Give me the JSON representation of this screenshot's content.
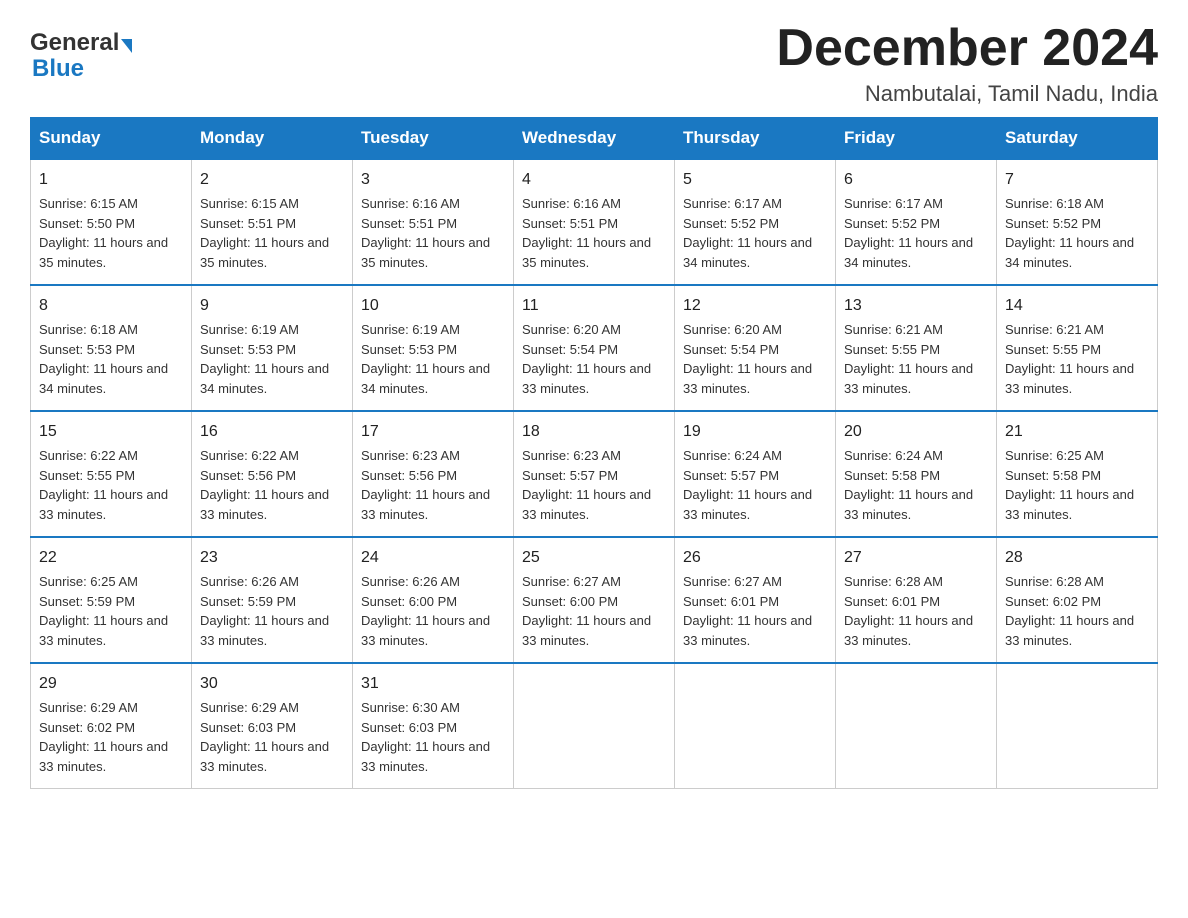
{
  "logo": {
    "general": "General",
    "blue": "Blue"
  },
  "title": "December 2024",
  "subtitle": "Nambutalai, Tamil Nadu, India",
  "headers": [
    "Sunday",
    "Monday",
    "Tuesday",
    "Wednesday",
    "Thursday",
    "Friday",
    "Saturday"
  ],
  "weeks": [
    [
      {
        "day": "1",
        "sunrise": "6:15 AM",
        "sunset": "5:50 PM",
        "daylight": "11 hours and 35 minutes."
      },
      {
        "day": "2",
        "sunrise": "6:15 AM",
        "sunset": "5:51 PM",
        "daylight": "11 hours and 35 minutes."
      },
      {
        "day": "3",
        "sunrise": "6:16 AM",
        "sunset": "5:51 PM",
        "daylight": "11 hours and 35 minutes."
      },
      {
        "day": "4",
        "sunrise": "6:16 AM",
        "sunset": "5:51 PM",
        "daylight": "11 hours and 35 minutes."
      },
      {
        "day": "5",
        "sunrise": "6:17 AM",
        "sunset": "5:52 PM",
        "daylight": "11 hours and 34 minutes."
      },
      {
        "day": "6",
        "sunrise": "6:17 AM",
        "sunset": "5:52 PM",
        "daylight": "11 hours and 34 minutes."
      },
      {
        "day": "7",
        "sunrise": "6:18 AM",
        "sunset": "5:52 PM",
        "daylight": "11 hours and 34 minutes."
      }
    ],
    [
      {
        "day": "8",
        "sunrise": "6:18 AM",
        "sunset": "5:53 PM",
        "daylight": "11 hours and 34 minutes."
      },
      {
        "day": "9",
        "sunrise": "6:19 AM",
        "sunset": "5:53 PM",
        "daylight": "11 hours and 34 minutes."
      },
      {
        "day": "10",
        "sunrise": "6:19 AM",
        "sunset": "5:53 PM",
        "daylight": "11 hours and 34 minutes."
      },
      {
        "day": "11",
        "sunrise": "6:20 AM",
        "sunset": "5:54 PM",
        "daylight": "11 hours and 33 minutes."
      },
      {
        "day": "12",
        "sunrise": "6:20 AM",
        "sunset": "5:54 PM",
        "daylight": "11 hours and 33 minutes."
      },
      {
        "day": "13",
        "sunrise": "6:21 AM",
        "sunset": "5:55 PM",
        "daylight": "11 hours and 33 minutes."
      },
      {
        "day": "14",
        "sunrise": "6:21 AM",
        "sunset": "5:55 PM",
        "daylight": "11 hours and 33 minutes."
      }
    ],
    [
      {
        "day": "15",
        "sunrise": "6:22 AM",
        "sunset": "5:55 PM",
        "daylight": "11 hours and 33 minutes."
      },
      {
        "day": "16",
        "sunrise": "6:22 AM",
        "sunset": "5:56 PM",
        "daylight": "11 hours and 33 minutes."
      },
      {
        "day": "17",
        "sunrise": "6:23 AM",
        "sunset": "5:56 PM",
        "daylight": "11 hours and 33 minutes."
      },
      {
        "day": "18",
        "sunrise": "6:23 AM",
        "sunset": "5:57 PM",
        "daylight": "11 hours and 33 minutes."
      },
      {
        "day": "19",
        "sunrise": "6:24 AM",
        "sunset": "5:57 PM",
        "daylight": "11 hours and 33 minutes."
      },
      {
        "day": "20",
        "sunrise": "6:24 AM",
        "sunset": "5:58 PM",
        "daylight": "11 hours and 33 minutes."
      },
      {
        "day": "21",
        "sunrise": "6:25 AM",
        "sunset": "5:58 PM",
        "daylight": "11 hours and 33 minutes."
      }
    ],
    [
      {
        "day": "22",
        "sunrise": "6:25 AM",
        "sunset": "5:59 PM",
        "daylight": "11 hours and 33 minutes."
      },
      {
        "day": "23",
        "sunrise": "6:26 AM",
        "sunset": "5:59 PM",
        "daylight": "11 hours and 33 minutes."
      },
      {
        "day": "24",
        "sunrise": "6:26 AM",
        "sunset": "6:00 PM",
        "daylight": "11 hours and 33 minutes."
      },
      {
        "day": "25",
        "sunrise": "6:27 AM",
        "sunset": "6:00 PM",
        "daylight": "11 hours and 33 minutes."
      },
      {
        "day": "26",
        "sunrise": "6:27 AM",
        "sunset": "6:01 PM",
        "daylight": "11 hours and 33 minutes."
      },
      {
        "day": "27",
        "sunrise": "6:28 AM",
        "sunset": "6:01 PM",
        "daylight": "11 hours and 33 minutes."
      },
      {
        "day": "28",
        "sunrise": "6:28 AM",
        "sunset": "6:02 PM",
        "daylight": "11 hours and 33 minutes."
      }
    ],
    [
      {
        "day": "29",
        "sunrise": "6:29 AM",
        "sunset": "6:02 PM",
        "daylight": "11 hours and 33 minutes."
      },
      {
        "day": "30",
        "sunrise": "6:29 AM",
        "sunset": "6:03 PM",
        "daylight": "11 hours and 33 minutes."
      },
      {
        "day": "31",
        "sunrise": "6:30 AM",
        "sunset": "6:03 PM",
        "daylight": "11 hours and 33 minutes."
      },
      null,
      null,
      null,
      null
    ]
  ],
  "labels": {
    "sunrise_prefix": "Sunrise: ",
    "sunset_prefix": "Sunset: ",
    "daylight_prefix": "Daylight: "
  }
}
